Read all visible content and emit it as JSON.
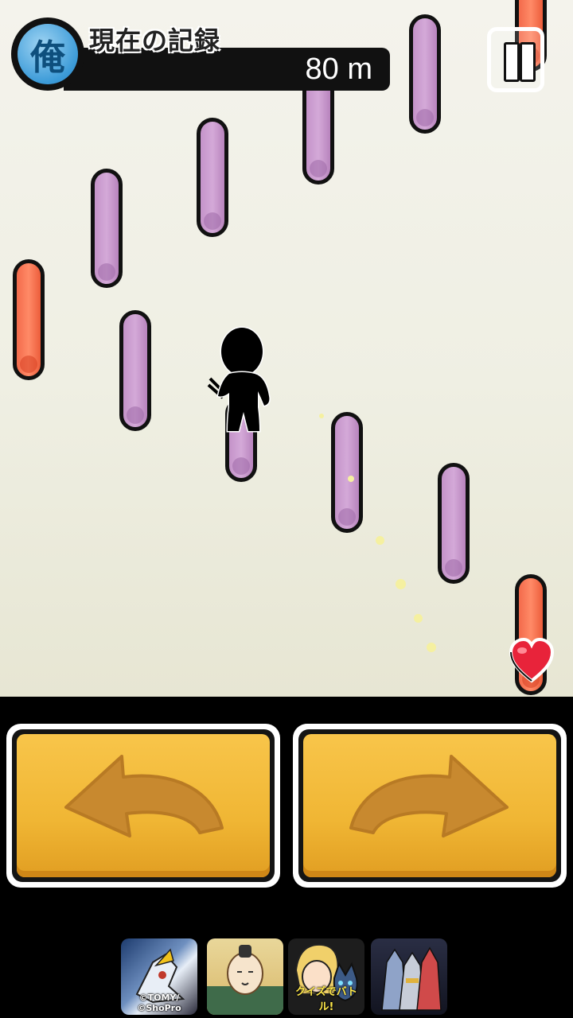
{
  "hud": {
    "badge_char": "俺",
    "record_label": "現在の記録",
    "record_value": "80 m"
  },
  "pause_button": {
    "icon": "pause-icon"
  },
  "pillars": [
    {
      "color": "purple",
      "label": "pillar"
    },
    {
      "color": "red",
      "label": "pillar"
    }
  ],
  "controls": {
    "left_icon": "turn-left-arrow-icon",
    "right_icon": "turn-right-arrow-icon"
  },
  "lives": {
    "icon": "heart-icon"
  },
  "ads": [
    {
      "name": "ad-mech-game",
      "caption": "©TOMY/©ShoPro"
    },
    {
      "name": "ad-samurai-game",
      "caption": ""
    },
    {
      "name": "ad-quiz-battle",
      "caption": "クイズでバトル!"
    },
    {
      "name": "ad-heroes-game",
      "caption": ""
    }
  ],
  "colors": {
    "button_gold": "#f0b634",
    "pillar_purple": "#c493c9",
    "pillar_red": "#f36b4b",
    "badge_blue": "#3c9bd8"
  }
}
